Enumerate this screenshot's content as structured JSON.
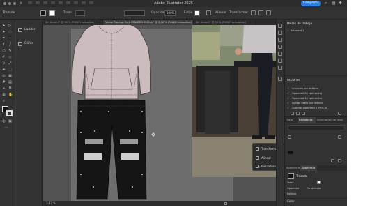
{
  "window": {
    "title": "Adobe Illustrator 2025",
    "share_label": "Compartir"
  },
  "control_bar": {
    "selection_label": "Trazado",
    "style_label": "Trazo",
    "opacity_label": "Opacidad",
    "opacity_value": "100%",
    "style_box_label": "Estilo",
    "align_label": "Alinear",
    "transform_label": "Transformar"
  },
  "tabs": [
    {
      "label": "Sin título-1* @ 50 % (RGB/Previsualizar)",
      "active": false
    },
    {
      "label": "Vector Mockup Pack UPDATED 2021.ai* @ 3,42 % (RGB/Previsualizar)",
      "active": true
    },
    {
      "label": "Sin título-2* @ 34 % (RGB/Previsualizar)",
      "active": false
    }
  ],
  "mini_panel": {
    "items": [
      {
        "label": "Ladder",
        "icon": "libraries-icon"
      },
      {
        "label": "Glifos",
        "icon": "glyphs-icon"
      }
    ]
  },
  "context_menu": {
    "items": [
      {
        "label": "Transformar",
        "icon": "transform-icon"
      },
      {
        "label": "Alinear",
        "icon": "align-icon"
      },
      {
        "label": "Buscafiores",
        "icon": "pathfinder-icon"
      }
    ]
  },
  "status_bar": {
    "zoom": "3,42 %"
  },
  "layers_panel": {
    "title": "Mesas de trabajo",
    "items": [
      {
        "number": "1",
        "label": "Artboard 1"
      }
    ]
  },
  "actions_panel": {
    "title": "Acciones",
    "items": [
      "Acciones por defecto",
      "Opacidad 60 (selección)",
      "Opacidad 40 (selección)",
      "Aplicar estilo por defecto",
      "Guardar para Web y JPEG 60"
    ]
  },
  "properties_tabs": [
    {
      "label": "Trazo",
      "active": false
    },
    {
      "label": "Bibliotecas",
      "active": true
    },
    {
      "label": "Información de texto",
      "active": false
    }
  ],
  "appearance_tabs": [
    {
      "label": "Apariencia",
      "active": false
    },
    {
      "label": "Apariencia",
      "active": true
    }
  ],
  "appearance_panel": {
    "object_label": "Trazado",
    "stroke_label": "Trazo",
    "opacity_label": "Opacidad",
    "opacity_value": "Por defecto",
    "fill_label": "Relleno"
  },
  "color_panel": {
    "title": "Color"
  },
  "colors": {
    "hoodie": "#cdbcbe",
    "pants": "#151515",
    "accent": "#2680eb"
  }
}
